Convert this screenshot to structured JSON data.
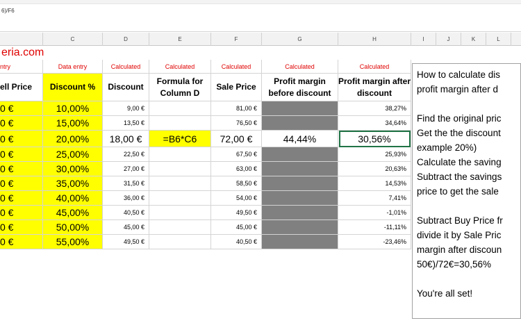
{
  "formula_bar": {
    "text": "6)/F6"
  },
  "columns": [
    "C",
    "D",
    "E",
    "F",
    "G",
    "H",
    "I",
    "J",
    "K",
    "L"
  ],
  "logo_text": "eria.com",
  "labels": {
    "a": "ntry",
    "c": "Data entry",
    "d": "Calculated",
    "e": "Calculated",
    "f": "Calculated",
    "g": "Calculated",
    "h": "Calculated"
  },
  "headers": {
    "b": "ell Price",
    "c": "Discount %",
    "d": "Discount",
    "e": "Formula for Column D",
    "f": "Sale Price",
    "g": "Profit margin before discount",
    "h": "Profit margin after discount"
  },
  "rows": [
    {
      "b": "0 €",
      "c": "10,00%",
      "d": "9,00 €",
      "e": "",
      "f": "81,00 €",
      "g": "",
      "h": "38,27%"
    },
    {
      "b": "0 €",
      "c": "15,00%",
      "d": "13,50 €",
      "e": "",
      "f": "76,50 €",
      "g": "",
      "h": "34,64%"
    },
    {
      "b": "0 €",
      "c": "20,00%",
      "d": "18,00 €",
      "e": "=B6*C6",
      "f": "72,00 €",
      "g": "44,44%",
      "h": "30,56%"
    },
    {
      "b": "0 €",
      "c": "25,00%",
      "d": "22,50 €",
      "e": "",
      "f": "67,50 €",
      "g": "",
      "h": "25,93%"
    },
    {
      "b": "0 €",
      "c": "30,00%",
      "d": "27,00 €",
      "e": "",
      "f": "63,00 €",
      "g": "",
      "h": "20,63%"
    },
    {
      "b": "0 €",
      "c": "35,00%",
      "d": "31,50 €",
      "e": "",
      "f": "58,50 €",
      "g": "",
      "h": "14,53%"
    },
    {
      "b": "0 €",
      "c": "40,00%",
      "d": "36,00 €",
      "e": "",
      "f": "54,00 €",
      "g": "",
      "h": "7,41%"
    },
    {
      "b": "0 €",
      "c": "45,00%",
      "d": "40,50 €",
      "e": "",
      "f": "49,50 €",
      "g": "",
      "h": "-1,01%"
    },
    {
      "b": "0 €",
      "c": "50,00%",
      "d": "45,00 €",
      "e": "",
      "f": "45,00 €",
      "g": "",
      "h": "-11,11%"
    },
    {
      "b": "0 €",
      "c": "55,00%",
      "d": "49,50 €",
      "e": "",
      "f": "40,50 €",
      "g": "",
      "h": "-23,46%"
    }
  ],
  "note": {
    "lines": [
      "How to calculate dis",
      "profit margin after d",
      "",
      "Find the original pric",
      "Get the the discount",
      "example 20%)",
      "Calculate the saving",
      "Subtract the savings",
      "price to get the sale",
      "",
      "Subtract Buy Price fr",
      "divide it by Sale Pric",
      "margin after discoun",
      "50€)/72€=30,56%",
      "",
      "You're all set!"
    ]
  }
}
